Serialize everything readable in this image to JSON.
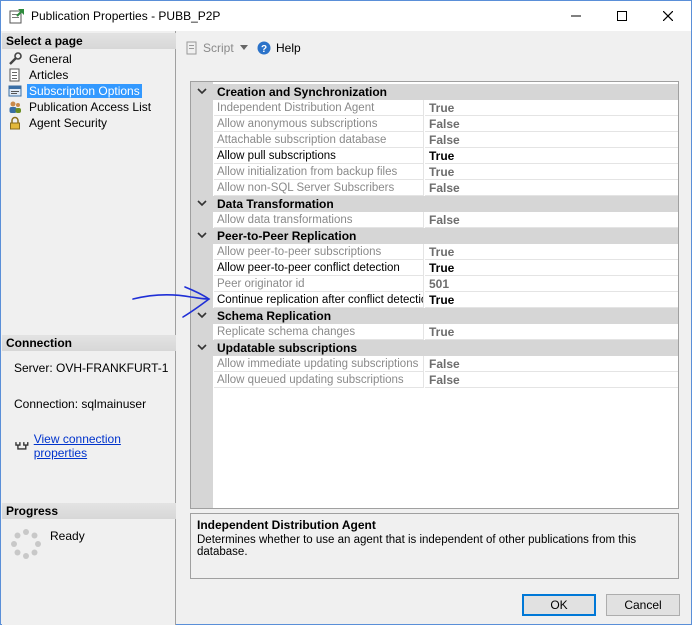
{
  "window": {
    "title": "Publication Properties - PUBB_P2P"
  },
  "left": {
    "select_page_header": "Select a page",
    "pages": [
      {
        "label": "General",
        "icon": "wrench-icon"
      },
      {
        "label": "Articles",
        "icon": "articles-icon"
      },
      {
        "label": "Subscription Options",
        "icon": "subscription-options-icon",
        "selected": true
      },
      {
        "label": "Publication Access List",
        "icon": "users-icon"
      },
      {
        "label": "Agent Security",
        "icon": "lock-icon"
      }
    ],
    "connection_header": "Connection",
    "server": "Server: OVH-FRANKFURT-1",
    "connection": "Connection: sqlmainuser",
    "view_link": "View connection properties",
    "progress_header": "Progress",
    "progress_status": "Ready"
  },
  "toolbar": {
    "script_label": "Script",
    "help_label": "Help"
  },
  "grid": {
    "categories": [
      {
        "label": "Creation and Synchronization",
        "rows": [
          {
            "name": "Independent Distribution Agent",
            "value": "True",
            "readonly": true
          },
          {
            "name": "Allow anonymous subscriptions",
            "value": "False",
            "readonly": true
          },
          {
            "name": "Attachable subscription database",
            "value": "False",
            "readonly": true
          },
          {
            "name": "Allow pull subscriptions",
            "value": "True",
            "readonly": false
          },
          {
            "name": "Allow initialization from backup files",
            "value": "True",
            "readonly": true
          },
          {
            "name": "Allow non-SQL Server Subscribers",
            "value": "False",
            "readonly": true
          }
        ]
      },
      {
        "label": "Data Transformation",
        "rows": [
          {
            "name": "Allow data transformations",
            "value": "False",
            "readonly": true
          }
        ]
      },
      {
        "label": "Peer-to-Peer Replication",
        "rows": [
          {
            "name": "Allow peer-to-peer subscriptions",
            "value": "True",
            "readonly": true
          },
          {
            "name": "Allow peer-to-peer conflict detection",
            "value": "True",
            "readonly": false
          },
          {
            "name": "Peer originator id",
            "value": "501",
            "readonly": true
          },
          {
            "name": "Continue replication after conflict detection",
            "value": "True",
            "readonly": false
          }
        ]
      },
      {
        "label": "Schema Replication",
        "rows": [
          {
            "name": "Replicate schema changes",
            "value": "True",
            "readonly": true
          }
        ]
      },
      {
        "label": "Updatable subscriptions",
        "rows": [
          {
            "name": "Allow immediate updating subscriptions",
            "value": "False",
            "readonly": true
          },
          {
            "name": "Allow queued updating subscriptions",
            "value": "False",
            "readonly": true
          }
        ]
      }
    ]
  },
  "description": {
    "title": "Independent Distribution Agent",
    "text": "Determines whether to use an agent that is independent of other publications from this database."
  },
  "buttons": {
    "ok": "OK",
    "cancel": "Cancel"
  },
  "colors": {
    "selection": "#3399ff",
    "link": "#0033cc",
    "annotation": "#1f2fd6"
  }
}
